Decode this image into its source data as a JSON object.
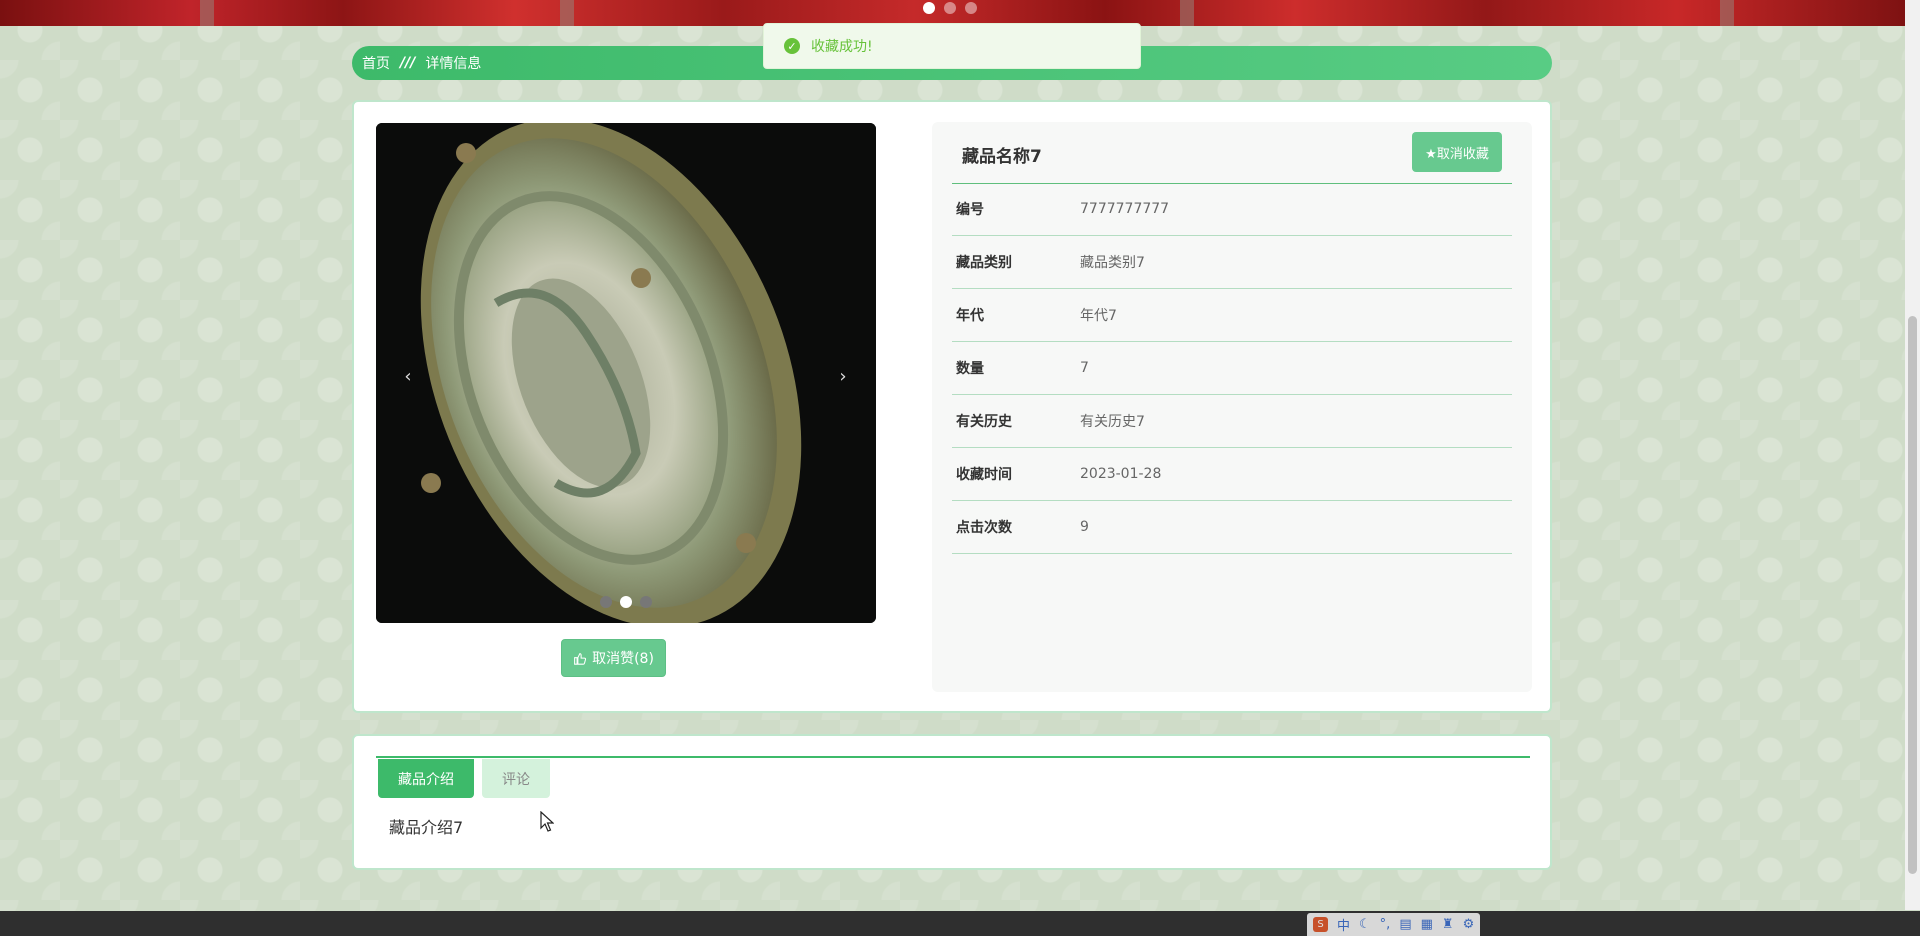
{
  "toast": {
    "message": "收藏成功!"
  },
  "breadcrumb": {
    "home": "首页",
    "separator": "///",
    "current": "详情信息"
  },
  "item": {
    "title": "藏品名称7",
    "favorite_button": "★取消收藏",
    "like_button": "取消赞(8)",
    "fields": [
      {
        "label": "编号",
        "value": "7777777777"
      },
      {
        "label": "藏品类别",
        "value": "藏品类别7"
      },
      {
        "label": "年代",
        "value": "年代7"
      },
      {
        "label": "数量",
        "value": "7"
      },
      {
        "label": "有关历史",
        "value": "有关历史7"
      },
      {
        "label": "收藏时间",
        "value": "2023-01-28"
      },
      {
        "label": "点击次数",
        "value": "9"
      }
    ]
  },
  "carousel": {
    "prev": "‹",
    "next": "›",
    "slide_count": 3,
    "active_index": 1
  },
  "banner": {
    "slide_count": 3,
    "active_index": 0
  },
  "tabs": [
    {
      "label": "藏品介绍",
      "active": true
    },
    {
      "label": "评论",
      "active": false
    }
  ],
  "tab_content": "藏品介绍7",
  "taskbar": {
    "ime_label": "中"
  },
  "colors": {
    "accent": "#3dba6a",
    "button": "#67c98f",
    "toast_text": "#67c23a"
  }
}
